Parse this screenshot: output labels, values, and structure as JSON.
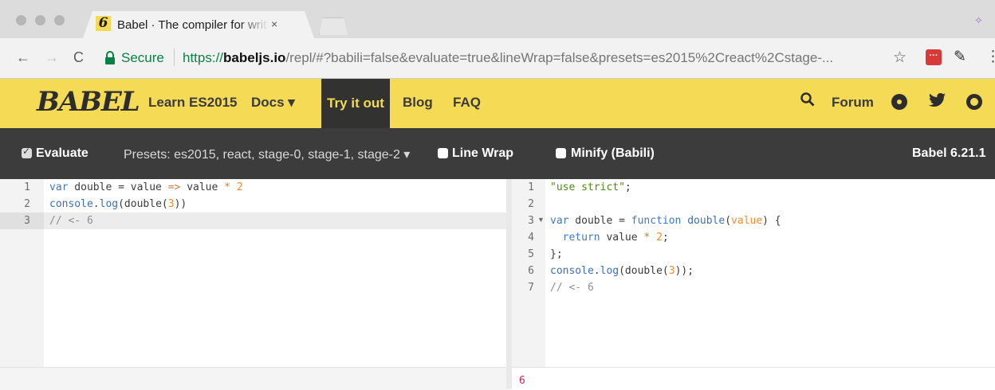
{
  "browser": {
    "tab_title": "Babel · The compiler for writing next generation JavaScript",
    "tab_close": "×",
    "back": "←",
    "forward": "→",
    "reload": "C",
    "secure_label": "Secure",
    "url_scheme": "https://",
    "url_host": "babeljs.io",
    "url_path": "/repl/#?babili=false&evaluate=true&lineWrap=false&presets=es2015%2Creact%2Cstage-...",
    "star": "☆",
    "ext_red": "···",
    "menu": "⋮"
  },
  "header": {
    "logo": "BABEL",
    "nav": [
      {
        "label": "Learn ES2015"
      },
      {
        "label": "Docs ▾"
      },
      {
        "label": "Try it out"
      },
      {
        "label": "Blog"
      },
      {
        "label": "FAQ"
      }
    ],
    "forum_label": "Forum",
    "search_icon": "search-icon",
    "twitter_icon": "twitter-icon",
    "github_icon": "github-icon",
    "accent_color": "#f5da55"
  },
  "toolbar": {
    "evaluate_label": "Evaluate",
    "presets_label": "Presets: es2015, react, stage-0, stage-1, stage-2 ▾",
    "line_wrap_label": "Line Wrap",
    "minify_label": "Minify (Babili)",
    "version": "Babel 6.21.1"
  },
  "editor_input": {
    "line_numbers": "1\n2\n3",
    "code": [
      "var double = value => value * 2",
      "console.log(double(3))",
      "// <- 6"
    ]
  },
  "editor_output": {
    "line_numbers": "1\n2\n3\n4\n5\n6\n7",
    "code": [
      "\"use strict\";",
      "",
      "var double = function double(value) {",
      "  return value * 2;",
      "};",
      "console.log(double(3));",
      "// <- 6"
    ]
  },
  "console_output": "6"
}
